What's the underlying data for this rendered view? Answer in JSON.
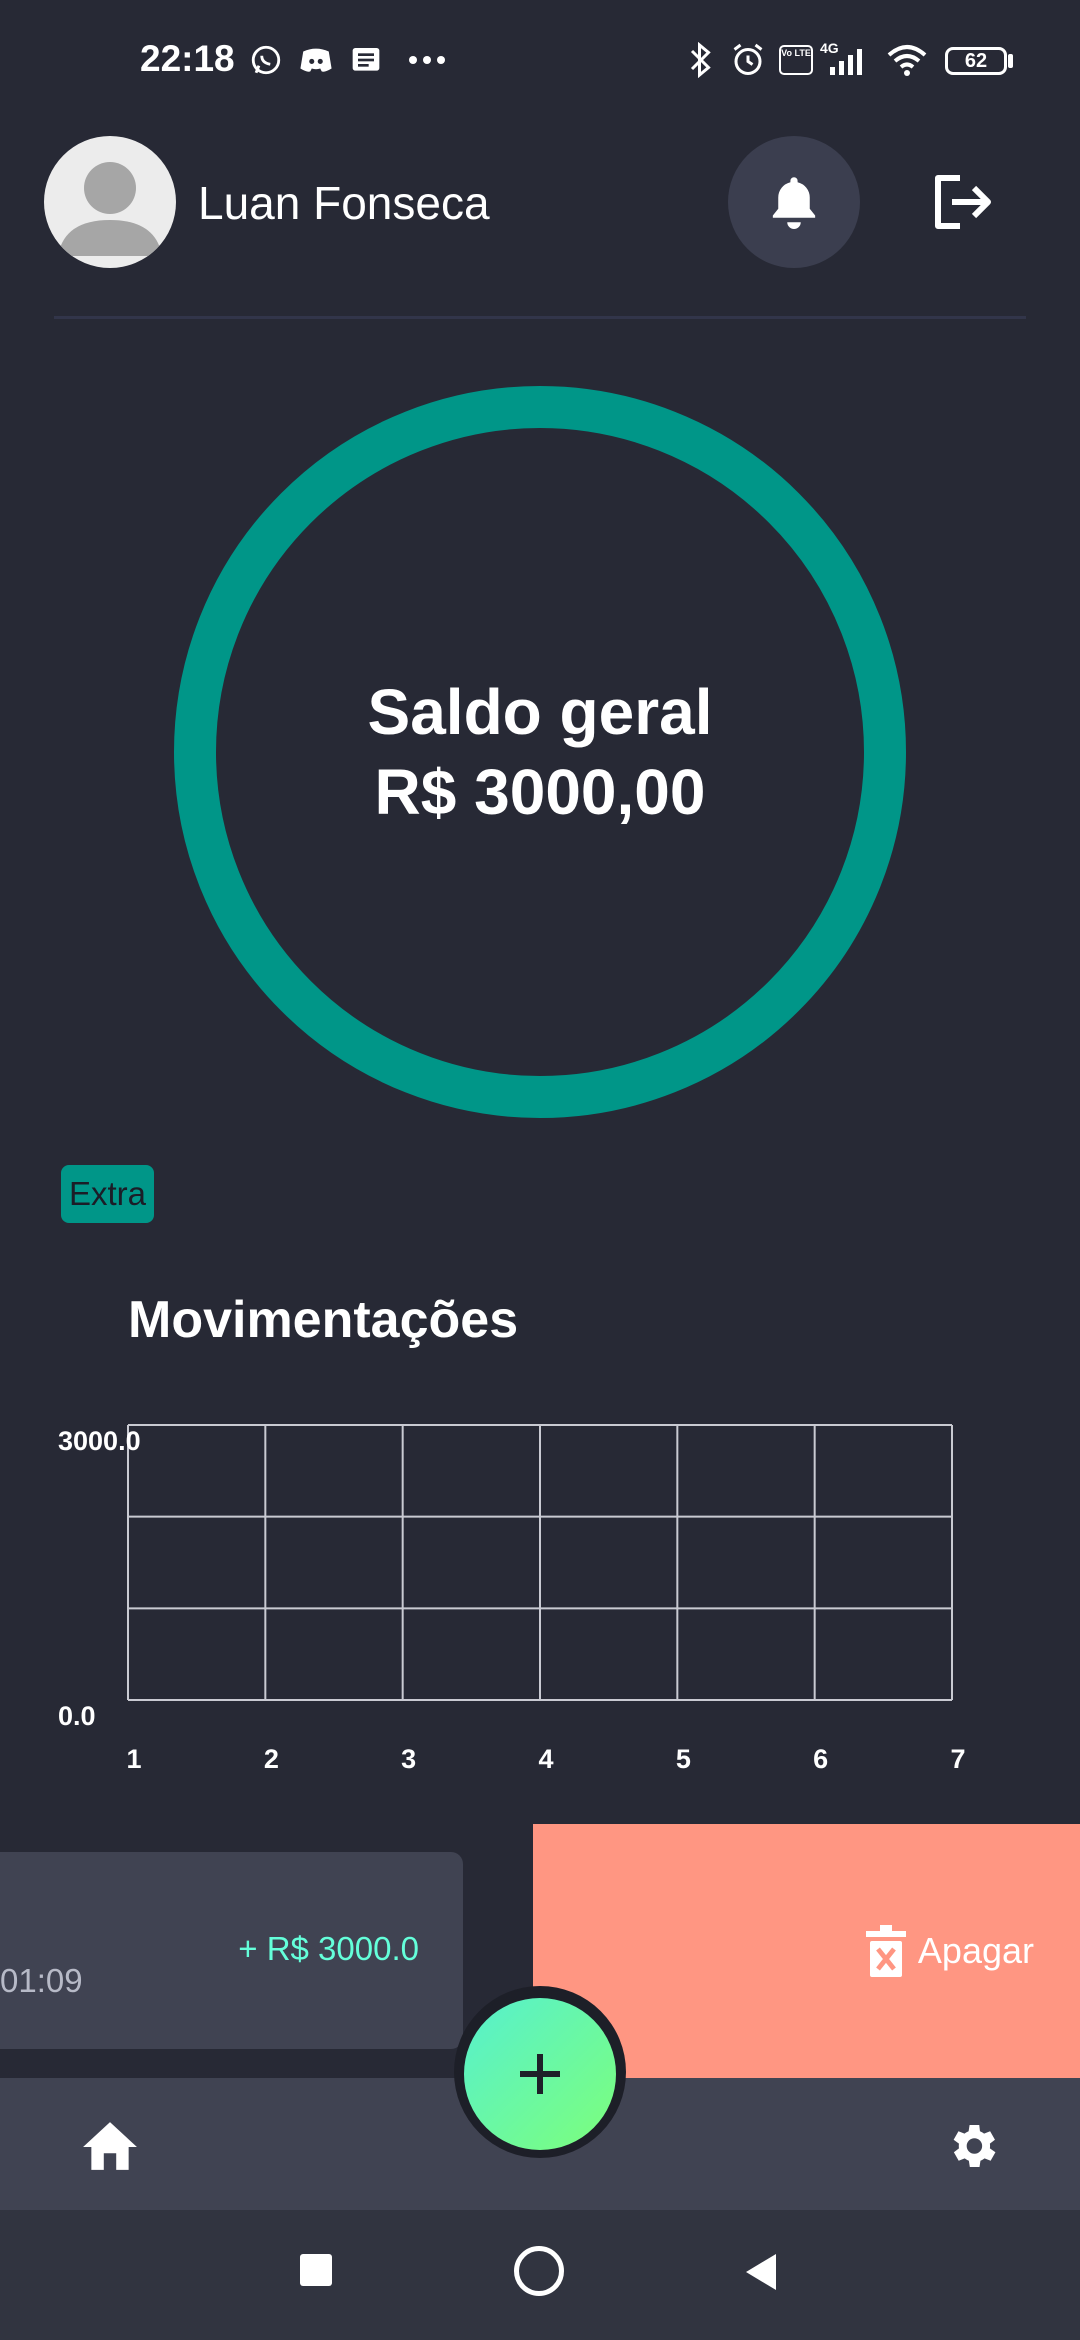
{
  "status_bar": {
    "time": "22:18",
    "network": "4G",
    "volte": "Vo LTE",
    "battery": "62",
    "icons": [
      "whatsapp-icon",
      "discord-icon",
      "message-icon",
      "more-dots-icon",
      "bluetooth-icon",
      "alarm-icon",
      "volte-icon",
      "signal-icon",
      "wifi-icon",
      "battery-icon"
    ]
  },
  "header": {
    "user_name": "Luan Fonseca",
    "icons": [
      "avatar-icon",
      "bell-icon",
      "logout-icon"
    ]
  },
  "balance": {
    "label": "Saldo geral",
    "value": "R$ 3000,00",
    "ring_color": "#009688"
  },
  "category_chip": {
    "label": "Extra",
    "color": "#009688"
  },
  "chart_data": {
    "type": "line",
    "title": "Movimentações",
    "x": [
      "1",
      "2",
      "3",
      "4",
      "5",
      "6",
      "7"
    ],
    "y_ticks": [
      "3000.0",
      "0.0"
    ],
    "ylim": [
      0,
      3000
    ],
    "grid": true,
    "series": []
  },
  "transaction": {
    "amount": "+ R$ 3000.0",
    "time": "01:09",
    "amount_color": "#64ffda"
  },
  "swipe_action": {
    "label": "Apagar",
    "color": "#ff9682",
    "icon": "trash-icon"
  },
  "bottom_nav": {
    "icons": [
      "home-icon",
      "settings-icon"
    ],
    "fab_icon": "plus-icon"
  },
  "colors": {
    "background": "#272935",
    "card": "#404352",
    "accent": "#009688"
  }
}
